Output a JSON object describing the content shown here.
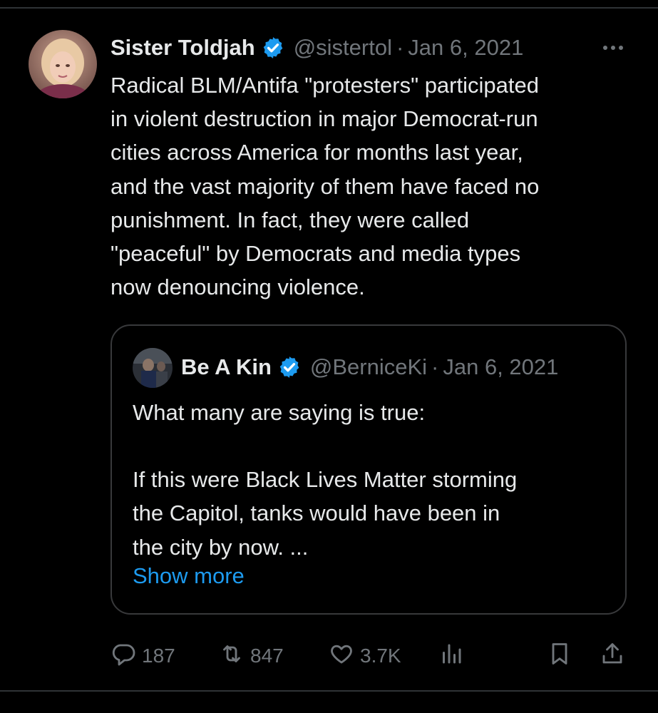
{
  "tweet": {
    "author_name": "Sister Toldjah",
    "handle": "@sistertol",
    "separator": "·",
    "date": "Jan 6, 2021",
    "verified_icon": "verified-badge-icon",
    "more_icon": "more-dots-icon",
    "body_lines": [
      "Radical BLM/Antifa \"protesters\" participated",
      "in violent destruction in major Democrat-run",
      "cities across America for months last year,",
      "and the vast majority of them have faced no",
      "punishment. In fact, they were called",
      "\"peaceful\" by Democrats and media types",
      "now denouncing violence."
    ]
  },
  "quote": {
    "author_name": "Be A Kin",
    "handle": "@BerniceKi",
    "separator": "·",
    "date": "Jan 6, 2021",
    "body_lines": [
      "What many are saying is true:",
      "",
      "If this were Black Lives Matter storming",
      "the Capitol, tanks would have been in",
      "the city by now. ..."
    ],
    "show_more": "Show more"
  },
  "actions": {
    "replies": "187",
    "reposts": "847",
    "likes": "3.7K",
    "icons": [
      "reply-icon",
      "repost-icon",
      "like-icon",
      "views-icon",
      "bookmark-icon",
      "share-icon"
    ]
  },
  "colors": {
    "background": "#000000",
    "text": "#e7e9ea",
    "secondary": "#71767b",
    "link": "#1d9bf0",
    "verified": "#1d9bf0"
  }
}
